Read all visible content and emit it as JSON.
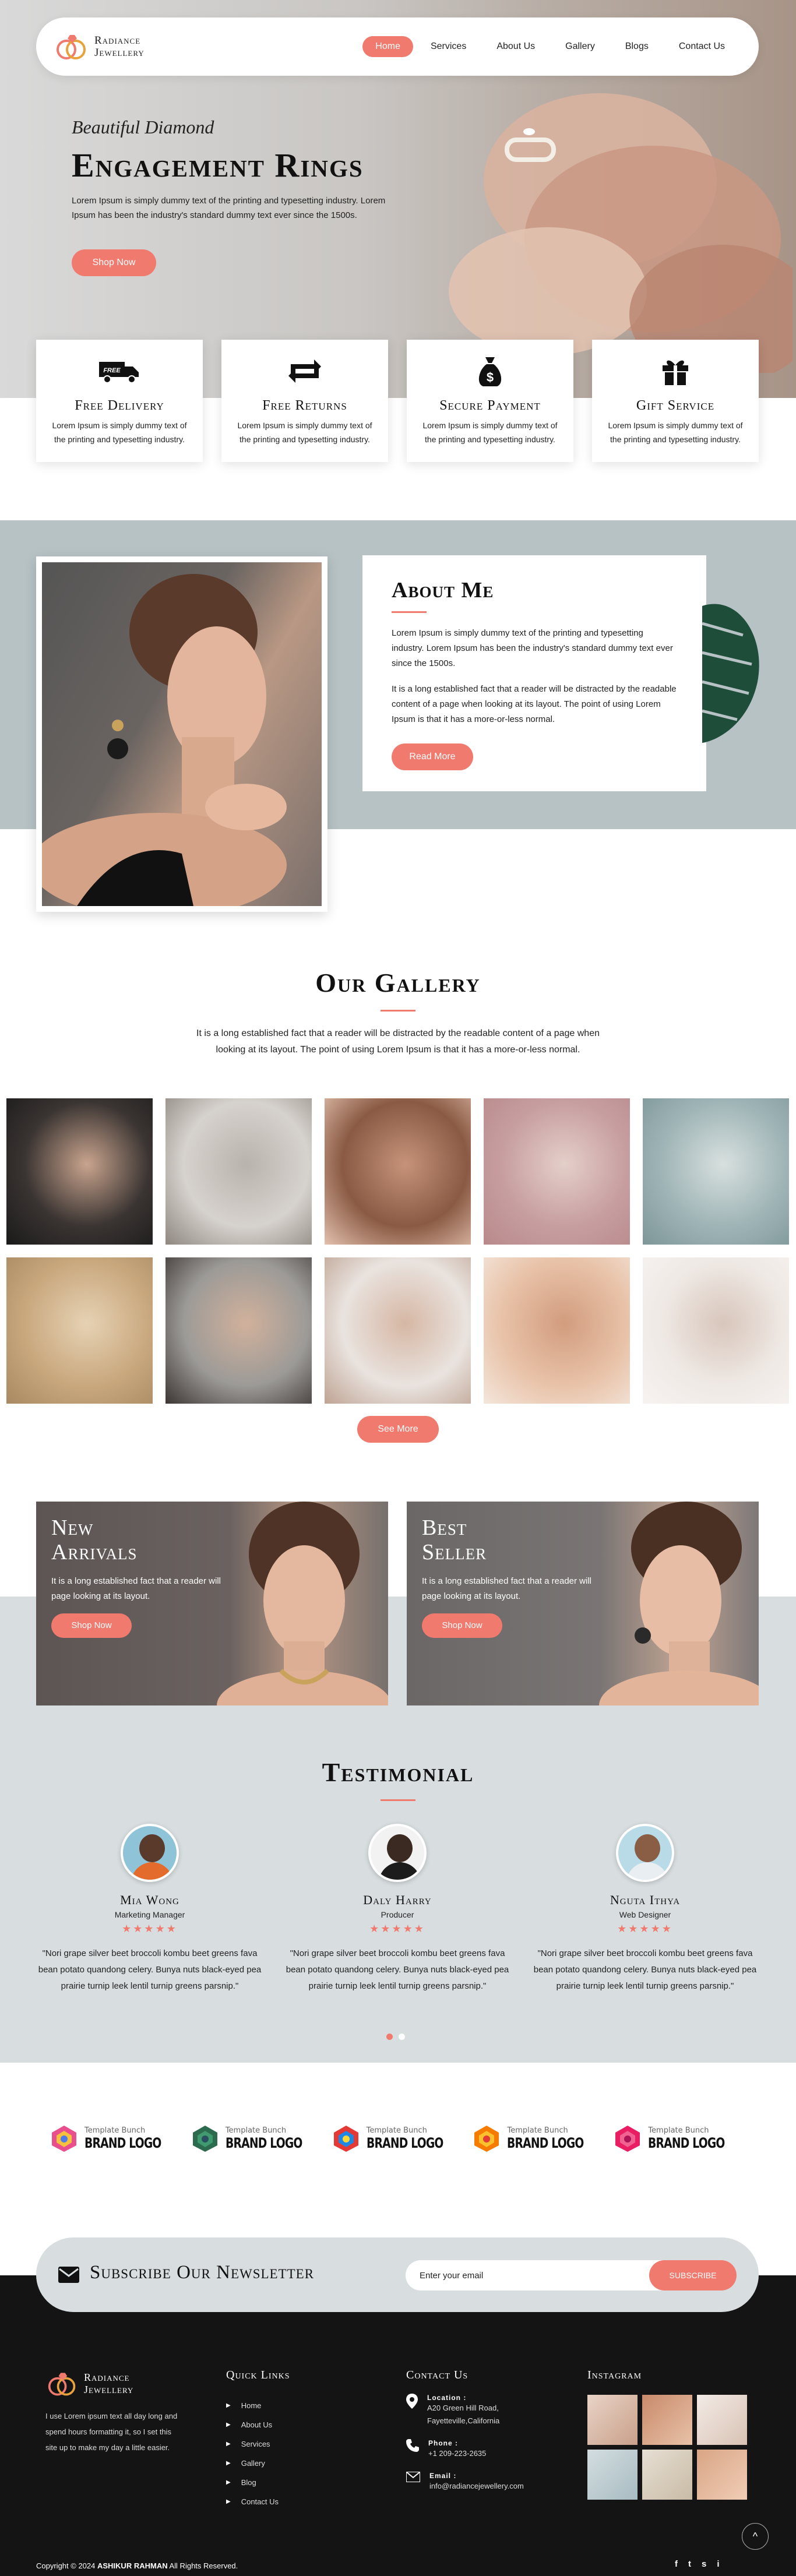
{
  "brand": {
    "line1": "Radiance",
    "line2": "Jewellery"
  },
  "nav": {
    "items": [
      {
        "label": "Home",
        "active": true
      },
      {
        "label": "Services",
        "active": false
      },
      {
        "label": "About Us",
        "active": false
      },
      {
        "label": "Gallery",
        "active": false
      },
      {
        "label": "Blogs",
        "active": false
      },
      {
        "label": "Contact Us",
        "active": false
      }
    ]
  },
  "hero": {
    "subtitle": "Beautiful Diamond",
    "title": "Engagement Rings",
    "text": "Lorem Ipsum is simply dummy text of the printing and typesetting industry. Lorem Ipsum has been the industry's standard dummy text ever since the 1500s.",
    "button": "Shop Now"
  },
  "features": [
    {
      "icon": "delivery-truck-icon",
      "title": "Free Delivery",
      "text": "Lorem Ipsum is simply dummy text of the printing and typesetting industry.",
      "badge": "FREE"
    },
    {
      "icon": "return-arrows-icon",
      "title": "Free Returns",
      "text": "Lorem Ipsum is simply dummy text of the printing and typesetting industry."
    },
    {
      "icon": "money-bag-icon",
      "title": "Secure Payment",
      "text": "Lorem Ipsum is simply dummy text of the printing and typesetting industry."
    },
    {
      "icon": "gift-icon",
      "title": "Gift Service",
      "text": "Lorem Ipsum is simply dummy text of the printing and typesetting industry."
    }
  ],
  "about": {
    "title": "About Me",
    "p1": "Lorem Ipsum is simply dummy text of the printing and typesetting industry. Lorem Ipsum has been the industry's standard dummy text ever since the 1500s.",
    "p2": "It is a long established fact that a reader will be distracted by the readable content of a page when looking at its layout. The point of using Lorem Ipsum is that it has a more-or-less normal.",
    "button": "Read More"
  },
  "gallery": {
    "title": "Our Gallery",
    "text": "It is a long established fact that a reader will be distracted by the readable content of a page when looking at its layout. The point of using Lorem Ipsum is that it has a more-or-less normal.",
    "button": "See More",
    "images": [
      {
        "name": "woman-earring-photo",
        "colors": [
          "#3a3432",
          "#c9a48e",
          "#1a1a1a"
        ]
      },
      {
        "name": "rings-dish-photo",
        "colors": [
          "#d6d2cd",
          "#b9b3ad",
          "#8e8780"
        ]
      },
      {
        "name": "bracelet-photo",
        "colors": [
          "#8a5a44",
          "#c6937a",
          "#e3c1ae"
        ]
      },
      {
        "name": "gold-pieces-photo",
        "colors": [
          "#c79ea0",
          "#e4cfc9",
          "#b8898b"
        ]
      },
      {
        "name": "bangles-box-photo",
        "colors": [
          "#9fb4b6",
          "#d8e0df",
          "#7e9698"
        ]
      },
      {
        "name": "gold-earrings-photo",
        "colors": [
          "#c9a87e",
          "#e6d2b4",
          "#a88961"
        ]
      },
      {
        "name": "smiling-woman-photo",
        "colors": [
          "#9c9a97",
          "#d1b19c",
          "#3c3533"
        ]
      },
      {
        "name": "woman-rings-photo",
        "colors": [
          "#e9e3df",
          "#d6b7a4",
          "#bfa393"
        ]
      },
      {
        "name": "hands-rings-photo",
        "colors": [
          "#e8c2a8",
          "#d29c7e",
          "#f4e6dc"
        ]
      },
      {
        "name": "bride-necklace-photo",
        "colors": [
          "#efe9e5",
          "#d8c6bb",
          "#f7f3f0"
        ]
      }
    ]
  },
  "promos": [
    {
      "title1": "New",
      "title2": "Arrivals",
      "text": "It is a long established fact that a reader will page looking at its layout.",
      "button": "Shop Now"
    },
    {
      "title1": "Best",
      "title2": "Seller",
      "text": "It is a long established fact that a reader will page looking at its layout.",
      "button": "Shop Now"
    }
  ],
  "testimonial": {
    "title": "Testimonial",
    "items": [
      {
        "name": "Mia Wong",
        "role": "Marketing Manager",
        "stars": "★★★★★",
        "quote": "\"Nori grape silver beet broccoli kombu beet greens fava bean potato quandong celery. Bunya nuts black-eyed pea prairie turnip leek lentil turnip greens parsnip.\"",
        "avatar_colors": [
          "#8fc3d8",
          "#e36b2c",
          "#5a3b2b"
        ]
      },
      {
        "name": "Daly Harry",
        "role": "Producer",
        "stars": "★★★★★",
        "quote": "\"Nori grape silver beet broccoli kombu beet greens fava bean potato quandong celery. Bunya nuts black-eyed pea prairie turnip leek lentil turnip greens parsnip.\"",
        "avatar_colors": [
          "#f2f2f2",
          "#1c1c1c",
          "#3a2a22"
        ]
      },
      {
        "name": "Nguta Ithya",
        "role": "Web Designer",
        "stars": "★★★★★",
        "quote": "\"Nori grape silver beet broccoli kombu beet greens fava bean potato quandong celery. Bunya nuts black-eyed pea prairie turnip leek lentil turnip greens parsnip.\"",
        "avatar_colors": [
          "#b9dbe8",
          "#e8eef1",
          "#8a5e44"
        ]
      }
    ],
    "dots": [
      true,
      false
    ]
  },
  "brands": [
    {
      "small": "Template Bunch",
      "big": "BRAND LOGO",
      "colors": [
        "#e84f8c",
        "#f6c23e",
        "#4f7be8"
      ]
    },
    {
      "small": "Template Bunch",
      "big": "BRAND LOGO",
      "colors": [
        "#2d6b4f",
        "#3f9a6f",
        "#2b4f5f"
      ]
    },
    {
      "small": "Template Bunch",
      "big": "BRAND LOGO",
      "colors": [
        "#e53935",
        "#1e88e5",
        "#fdd835"
      ]
    },
    {
      "small": "Template Bunch",
      "big": "BRAND LOGO",
      "colors": [
        "#f57c00",
        "#fbc02d",
        "#e53935"
      ]
    },
    {
      "small": "Template Bunch",
      "big": "BRAND LOGO",
      "colors": [
        "#e91e63",
        "#f06292",
        "#ad1457"
      ]
    }
  ],
  "newsletter": {
    "title": "Subscribe Our Newsletter",
    "placeholder": "Enter your email",
    "button": "SUBSCRIBE"
  },
  "footer": {
    "brand1": "Radiance",
    "brand2": "Jewellery",
    "about": "I use Lorem ipsum text all day long and spend hours formatting it, so I set this site up to make my day a little easier.",
    "links_title": "Quick Links",
    "links": [
      "Home",
      "About Us",
      "Services",
      "Gallery",
      "Blog",
      "Contact Us"
    ],
    "contact_title": "Contact Us",
    "location_label": "Location :",
    "location_value": "A20 Green Hill Road, Fayetteville,California",
    "phone_label": "Phone :",
    "phone_value": "+1 209-223-2635",
    "email_label": "Email :",
    "email_value": "info@radiancejewellery.com",
    "insta_title": "Instagram",
    "insta": [
      {
        "colors": [
          "#e9d3c6",
          "#c9a08a"
        ]
      },
      {
        "colors": [
          "#c98a6b",
          "#e8c2a8"
        ]
      },
      {
        "colors": [
          "#f2ebe6",
          "#d9c2b4"
        ]
      },
      {
        "colors": [
          "#d3dde0",
          "#a8bcc2"
        ]
      },
      {
        "colors": [
          "#e6dfd3",
          "#c9bba6"
        ]
      },
      {
        "colors": [
          "#d9a585",
          "#f0cdb6"
        ]
      }
    ],
    "copyright_pre": "Copyright © 2024",
    "copyright_name": "ASHIKUR RAHMAN",
    "copyright_post": "All Rights Reserved.",
    "social": [
      "f",
      "t",
      "s",
      "i"
    ],
    "back_top": "^"
  },
  "colors": {
    "accent": "#f07a6e",
    "dark": "#141414",
    "panel": "#d8dee0",
    "about_bg": "#b7c2c5"
  }
}
